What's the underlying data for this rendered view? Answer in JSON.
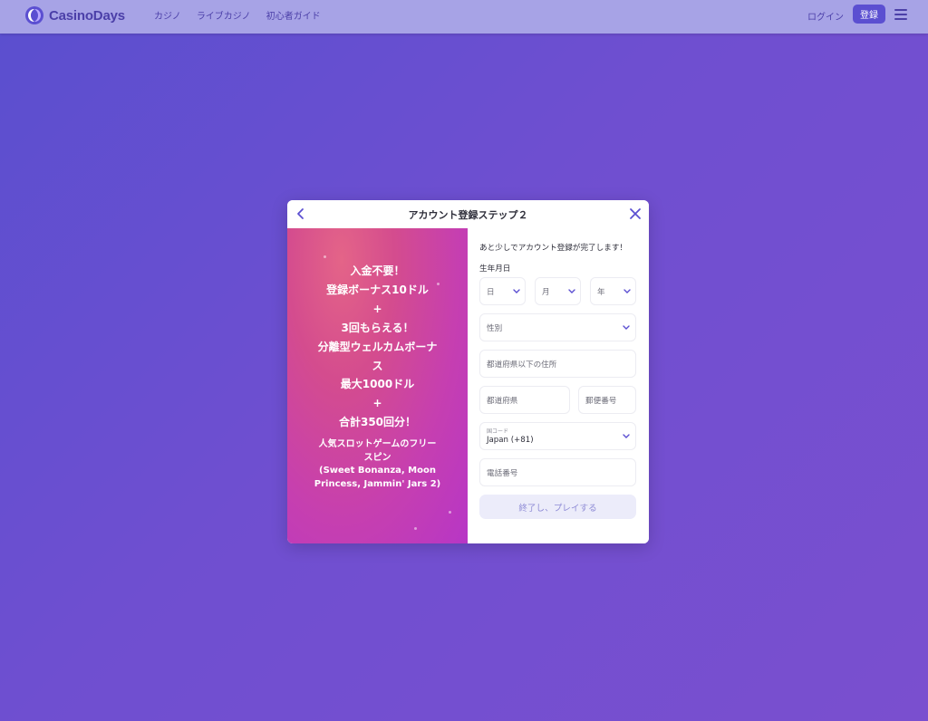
{
  "header": {
    "logo_text": "CasinoDays",
    "nav": [
      {
        "label": "カジノ"
      },
      {
        "label": "ライブカジノ"
      },
      {
        "label": "初心者ガイド"
      }
    ],
    "login_label": "ログイン",
    "register_label": "登録"
  },
  "modal": {
    "title": "アカウント登録ステップ２",
    "promo": {
      "lines": [
        "入金不要！",
        "登録ボーナス10ドル",
        "+",
        "3回もらえる！",
        "分離型ウェルカムボーナ",
        "ス",
        "最大1000ドル",
        "+",
        "合計350回分！"
      ],
      "sub_lines": [
        "人気スロットゲームのフリー",
        "スピン",
        "(Sweet Bonanza, Moon",
        "Princess, Jammin' Jars 2)"
      ]
    },
    "form": {
      "note": "あと少しでアカウント登録が完了します！",
      "birthdate_label": "生年月日",
      "day_placeholder": "日",
      "month_placeholder": "月",
      "year_placeholder": "年",
      "gender_placeholder": "性別",
      "address_placeholder": "都道府県以下の住所",
      "prefecture_placeholder": "都道府県",
      "postal_placeholder": "郵便番号",
      "country_code_label": "国コード",
      "country_code_value": "Japan (+81)",
      "phone_placeholder": "電話番号",
      "submit_label": "終了し、プレイする"
    }
  },
  "colors": {
    "background": "#6450d0",
    "navbar": "#a7a3e6",
    "accent": "#5b4fd1",
    "promo_start": "#e46488",
    "promo_end": "#b736c6",
    "button_disabled_bg": "#ececfa",
    "button_disabled_text": "#8f8cd6"
  }
}
